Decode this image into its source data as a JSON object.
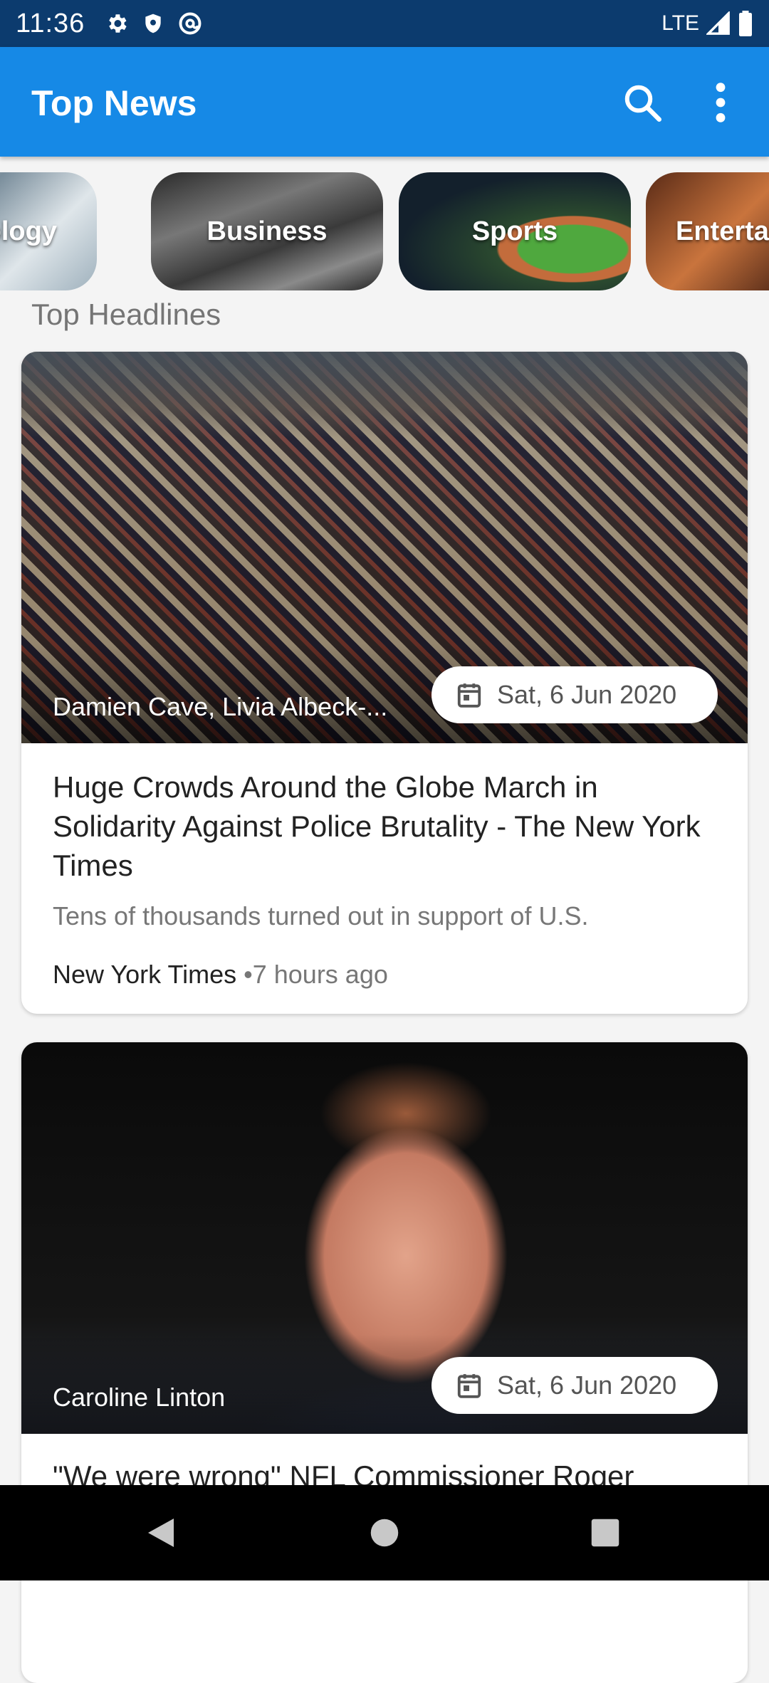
{
  "status_bar": {
    "time": "11:36",
    "network": "LTE",
    "icons": [
      "settings-icon",
      "shield-icon",
      "at-sign-icon",
      "signal-icon",
      "battery-icon"
    ]
  },
  "app_bar": {
    "title": "Top News",
    "color": "#1689e6",
    "actions": [
      "search-icon",
      "more-vert-icon"
    ]
  },
  "categories": [
    {
      "label": "nology"
    },
    {
      "label": "Business"
    },
    {
      "label": "Sports"
    },
    {
      "label": "Enterta"
    }
  ],
  "section_title": "Top Headlines",
  "articles": [
    {
      "author": "Damien Cave, Livia Albeck-...",
      "date": "Sat, 6 Jun 2020",
      "title": "Huge Crowds Around the Globe March in Solidarity Against Police Brutality - The New York Times",
      "description": "Tens of thousands turned out in support of U.S.",
      "source": "New York Times",
      "time_ago": "•7 hours ago"
    },
    {
      "author": "Caroline Linton",
      "date": "Sat, 6 Jun 2020",
      "title": "\"We were wrong\" NFL Commissioner Roger"
    }
  ],
  "nav_bar": {
    "buttons": [
      "back-icon",
      "home-icon",
      "recents-icon"
    ]
  }
}
